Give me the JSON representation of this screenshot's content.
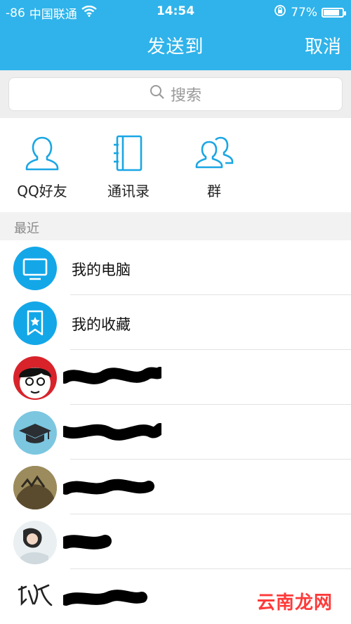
{
  "status_bar": {
    "signal": "-86",
    "carrier": "中国联通",
    "time": "14:54",
    "battery": "77%",
    "battery_level": 0.77
  },
  "nav": {
    "title": "发送到",
    "cancel_label": "取消"
  },
  "search": {
    "placeholder": "搜索"
  },
  "quick_actions": [
    {
      "label": "QQ好友",
      "icon": "person-icon"
    },
    {
      "label": "通讯录",
      "icon": "address-book-icon"
    },
    {
      "label": "群",
      "icon": "group-icon"
    }
  ],
  "recent": {
    "label": "最近",
    "items": [
      {
        "name": "我的电脑",
        "icon": "computer-icon"
      },
      {
        "name": "我的收藏",
        "icon": "bookmark-star-icon"
      }
    ]
  },
  "watermark": "云南龙网",
  "colors": {
    "primary": "#2fb3ea",
    "icon_blue": "#1aa6e4",
    "avatar_blue": "#13a7e8"
  }
}
